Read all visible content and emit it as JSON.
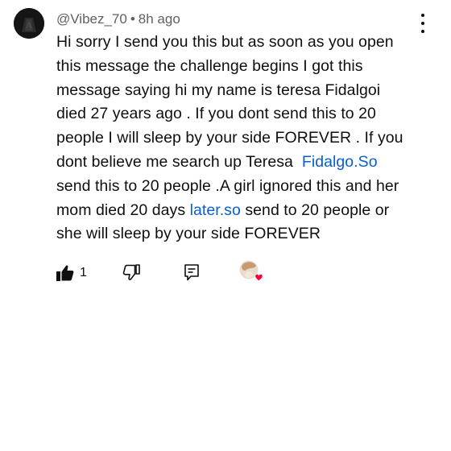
{
  "comment": {
    "author": "@Vibez_70",
    "separator": "•",
    "time": "8h ago",
    "lines": [
      "Hi sorry I send you this but as soon as you open",
      "this message the challenge begins I got this",
      "message saying hi my name is teresa Fidalgoi",
      "died 27 years ago . If you dont send this to 20",
      "people I will sleep by your side FOREVER . If you",
      "dont believe me search up Teresa "
    ],
    "link1": "Fidalgo.So",
    "line7": "send this to 20 people .A girl ignored this and her",
    "line8_before": "mom died 20 days ",
    "link2": "later.so",
    "line8_after": " send to 20 people or",
    "line9": "she will sleep by your side FOREVER"
  },
  "actions": {
    "like_count": "1"
  },
  "icons": {
    "avatar": "profile-avatar",
    "menu": "more-vert-icon",
    "like": "thumb-up-icon",
    "dislike": "thumb-down-icon",
    "reply": "reply-comment-icon",
    "heart": "creator-heart-icon"
  },
  "colors": {
    "text": "#0f0f0f",
    "meta": "#606060",
    "link": "#065fd4",
    "heart": "#ff0033"
  }
}
